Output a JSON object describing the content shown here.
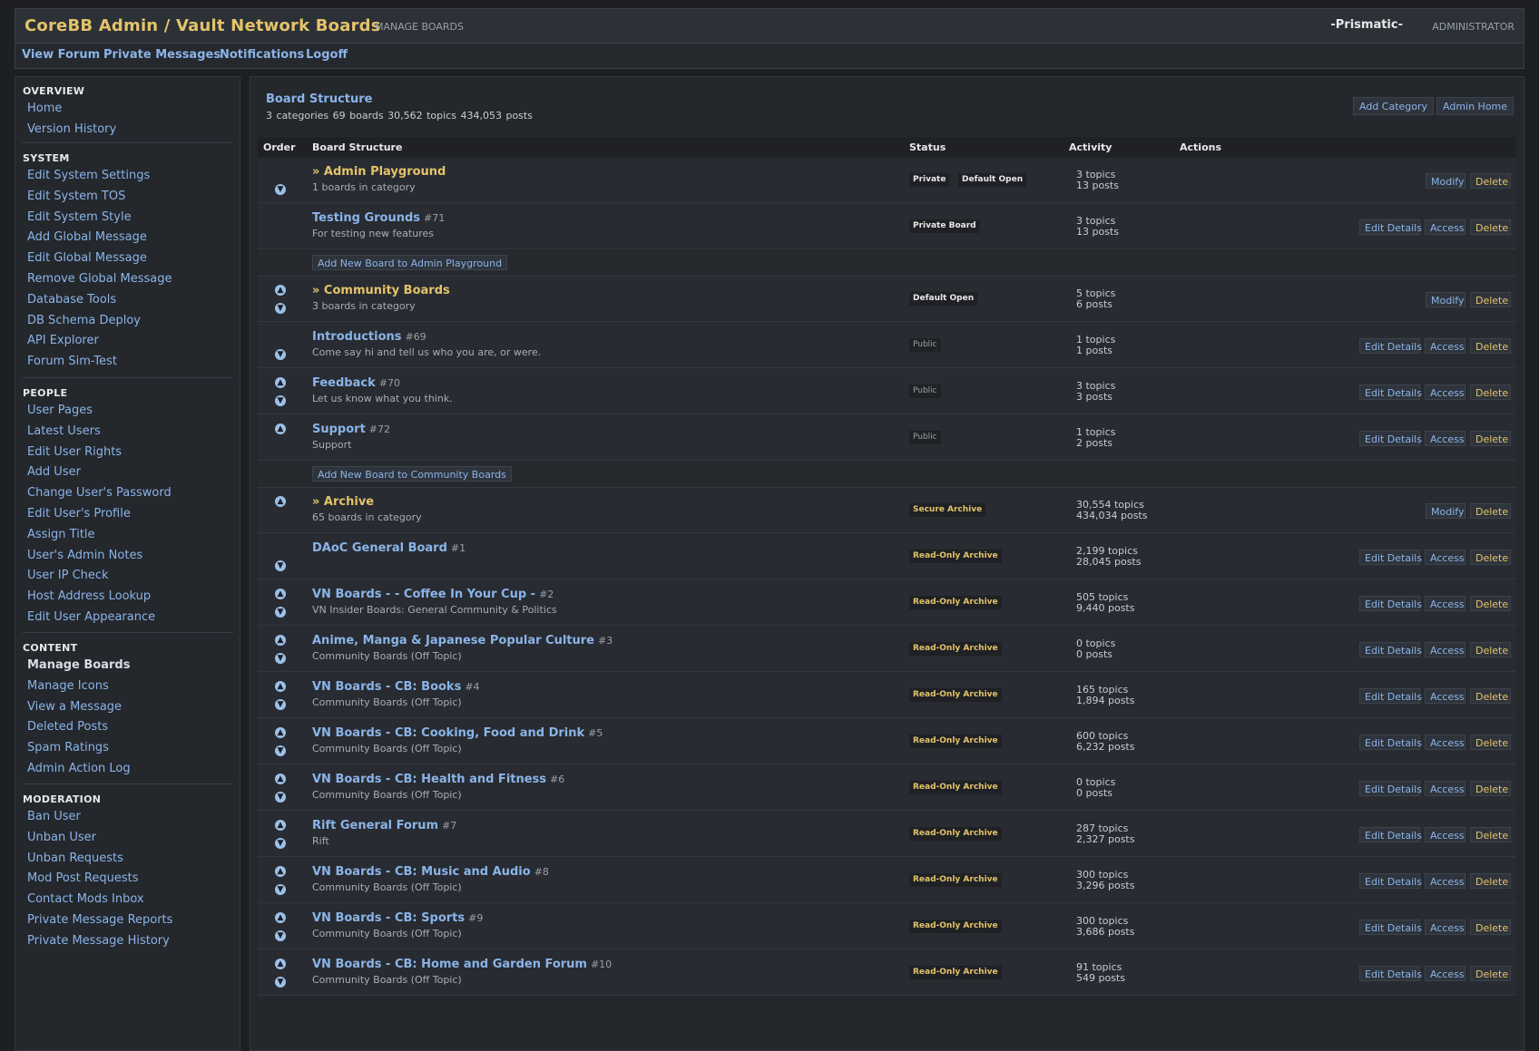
{
  "header": {
    "title": "CoreBB Admin / Vault Network Boards",
    "subtitle": "MANAGE BOARDS",
    "user_name": "-Prismatic-",
    "user_role": "ADMINISTRATOR"
  },
  "nav": [
    "View Forum",
    "Private Messages",
    "Notifications",
    "Logoff"
  ],
  "sidebar": {
    "sections": [
      {
        "title": "OVERVIEW",
        "items": [
          "Home",
          "Version History"
        ]
      },
      {
        "title": "SYSTEM",
        "items": [
          "Edit System Settings",
          "Edit System TOS",
          "Edit System Style",
          "Add Global Message",
          "Edit Global Message",
          "Remove Global Message",
          "Database Tools",
          "DB Schema Deploy",
          "API Explorer",
          "Forum Sim-Test"
        ]
      },
      {
        "title": "PEOPLE",
        "items": [
          "User Pages",
          "Latest Users",
          "Edit User Rights",
          "Add User",
          "Change User's Password",
          "Edit User's Profile",
          "Assign Title",
          "User's Admin Notes",
          "User IP Check",
          "Host Address Lookup",
          "Edit User Appearance"
        ]
      },
      {
        "title": "CONTENT",
        "items": [
          "Manage Boards",
          "Manage Icons",
          "View a Message",
          "Deleted Posts",
          "Spam Ratings",
          "Admin Action Log"
        ]
      },
      {
        "title": "MODERATION",
        "items": [
          "Ban User",
          "Unban User",
          "Unban Requests",
          "Mod Post Requests",
          "Contact Mods Inbox",
          "Private Message Reports",
          "Private Message History"
        ]
      }
    ],
    "active_item": "Manage Boards"
  },
  "panel": {
    "title": "Board Structure",
    "stats": "3 categories  69 boards  30,562 topics  434,053 posts",
    "buttons": [
      "Add Category",
      "Admin Home"
    ],
    "columns": [
      "Order",
      "Board Structure",
      "Status",
      "Activity",
      "Actions"
    ]
  },
  "rows": [
    {
      "kind": "cat",
      "name": "» Admin Playground",
      "desc": "1 boards in category",
      "status": [
        "Private",
        "Default Open"
      ],
      "topics": "3 topics",
      "posts": "13 posts",
      "actions": [
        "Modify",
        "Delete"
      ],
      "up": false,
      "down": true
    },
    {
      "kind": "board",
      "name": "Testing Grounds",
      "id": "#71",
      "desc": "For testing new features",
      "status": [
        "Private Board"
      ],
      "topics": "3 topics",
      "posts": "13 posts",
      "actions": [
        "Edit Details",
        "Access",
        "Delete"
      ],
      "up": false,
      "down": false
    },
    {
      "kind": "add",
      "label": "Add New Board to Admin Playground"
    },
    {
      "kind": "cat",
      "name": "» Community Boards",
      "desc": "3 boards in category",
      "status": [
        "Default Open"
      ],
      "topics": "5 topics",
      "posts": "6 posts",
      "actions": [
        "Modify",
        "Delete"
      ],
      "up": true,
      "down": true
    },
    {
      "kind": "board",
      "name": "Introductions",
      "id": "#69",
      "desc": "Come say hi and tell us who you are, or were.",
      "status": [
        "Public"
      ],
      "plain": true,
      "topics": "1 topics",
      "posts": "1 posts",
      "actions": [
        "Edit Details",
        "Access",
        "Delete"
      ],
      "up": false,
      "down": true
    },
    {
      "kind": "board",
      "name": "Feedback",
      "id": "#70",
      "desc": "Let us know what you think.",
      "status": [
        "Public"
      ],
      "plain": true,
      "topics": "3 topics",
      "posts": "3 posts",
      "actions": [
        "Edit Details",
        "Access",
        "Delete"
      ],
      "up": true,
      "down": true
    },
    {
      "kind": "board",
      "name": "Support",
      "id": "#72",
      "desc": "Support",
      "status": [
        "Public"
      ],
      "plain": true,
      "topics": "1 topics",
      "posts": "2 posts",
      "actions": [
        "Edit Details",
        "Access",
        "Delete"
      ],
      "up": true,
      "down": false
    },
    {
      "kind": "add",
      "label": "Add New Board to Community Boards"
    },
    {
      "kind": "cat",
      "name": "» Archive",
      "desc": "65 boards in category",
      "status": [
        "Secure Archive"
      ],
      "gold": true,
      "topics": "30,554 topics",
      "posts": "434,034 posts",
      "actions": [
        "Modify",
        "Delete"
      ],
      "up": true,
      "down": false
    },
    {
      "kind": "board",
      "name": "DAoC General Board",
      "id": "#1",
      "desc": "",
      "status": [
        "Read-Only Archive"
      ],
      "gold": true,
      "topics": "2,199 topics",
      "posts": "28,045 posts",
      "actions": [
        "Edit Details",
        "Access",
        "Delete"
      ],
      "up": false,
      "down": true
    },
    {
      "kind": "board",
      "name": "VN Boards - - Coffee In Your Cup -",
      "id": "#2",
      "desc": "VN Insider Boards: General Community & Politics",
      "status": [
        "Read-Only Archive"
      ],
      "gold": true,
      "topics": "505 topics",
      "posts": "9,440 posts",
      "actions": [
        "Edit Details",
        "Access",
        "Delete"
      ],
      "up": true,
      "down": true
    },
    {
      "kind": "board",
      "name": "Anime, Manga & Japanese Popular Culture",
      "id": "#3",
      "desc": "Community Boards (Off Topic)",
      "status": [
        "Read-Only Archive"
      ],
      "gold": true,
      "topics": "0 topics",
      "posts": "0 posts",
      "actions": [
        "Edit Details",
        "Access",
        "Delete"
      ],
      "up": true,
      "down": true
    },
    {
      "kind": "board",
      "name": "VN Boards - CB: Books",
      "id": "#4",
      "desc": "Community Boards (Off Topic)",
      "status": [
        "Read-Only Archive"
      ],
      "gold": true,
      "topics": "165 topics",
      "posts": "1,894 posts",
      "actions": [
        "Edit Details",
        "Access",
        "Delete"
      ],
      "up": true,
      "down": true
    },
    {
      "kind": "board",
      "name": "VN Boards - CB: Cooking, Food and Drink",
      "id": "#5",
      "desc": "Community Boards (Off Topic)",
      "status": [
        "Read-Only Archive"
      ],
      "gold": true,
      "topics": "600 topics",
      "posts": "6,232 posts",
      "actions": [
        "Edit Details",
        "Access",
        "Delete"
      ],
      "up": true,
      "down": true
    },
    {
      "kind": "board",
      "name": "VN Boards - CB: Health and Fitness",
      "id": "#6",
      "desc": "Community Boards (Off Topic)",
      "status": [
        "Read-Only Archive"
      ],
      "gold": true,
      "topics": "0 topics",
      "posts": "0 posts",
      "actions": [
        "Edit Details",
        "Access",
        "Delete"
      ],
      "up": true,
      "down": true
    },
    {
      "kind": "board",
      "name": "Rift General Forum",
      "id": "#7",
      "desc": "Rift",
      "status": [
        "Read-Only Archive"
      ],
      "gold": true,
      "topics": "287 topics",
      "posts": "2,327 posts",
      "actions": [
        "Edit Details",
        "Access",
        "Delete"
      ],
      "up": true,
      "down": true
    },
    {
      "kind": "board",
      "name": "VN Boards - CB: Music and Audio",
      "id": "#8",
      "desc": "Community Boards (Off Topic)",
      "status": [
        "Read-Only Archive"
      ],
      "gold": true,
      "topics": "300 topics",
      "posts": "3,296 posts",
      "actions": [
        "Edit Details",
        "Access",
        "Delete"
      ],
      "up": true,
      "down": true
    },
    {
      "kind": "board",
      "name": "VN Boards - CB: Sports",
      "id": "#9",
      "desc": "Community Boards (Off Topic)",
      "status": [
        "Read-Only Archive"
      ],
      "gold": true,
      "topics": "300 topics",
      "posts": "3,686 posts",
      "actions": [
        "Edit Details",
        "Access",
        "Delete"
      ],
      "up": true,
      "down": true
    },
    {
      "kind": "board",
      "name": "VN Boards - CB: Home and Garden Forum",
      "id": "#10",
      "desc": "Community Boards (Off Topic)",
      "status": [
        "Read-Only Archive"
      ],
      "gold": true,
      "topics": "91 topics",
      "posts": "549 posts",
      "actions": [
        "Edit Details",
        "Access",
        "Delete"
      ],
      "up": true,
      "down": true
    }
  ],
  "colors": {
    "accent_gold": "#e3c36a",
    "link_blue": "#8ab4e8",
    "bg": "#1d1f22",
    "panel": "#24272c"
  },
  "icons": {
    "move_up": "arrow-up-circle-icon",
    "move_down": "arrow-down-circle-icon"
  }
}
